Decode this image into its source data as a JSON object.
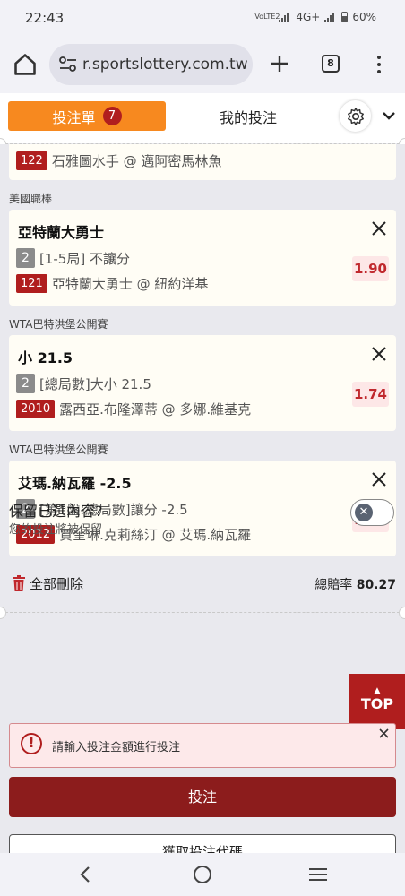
{
  "status_bar": {
    "time": "22:43",
    "network": "VoLTE2",
    "signal_label": "4G+",
    "battery": "60%"
  },
  "browser": {
    "url": "r.sportslottery.com.tw",
    "tab_count": "8"
  },
  "header": {
    "tab_betslip": "投注單",
    "betslip_count": "7",
    "tab_my_bets": "我的投注"
  },
  "partial_card": {
    "game_code": "122",
    "text": "石雅圖水手 @ 邁阿密馬林魚"
  },
  "bets": [
    {
      "league": "美國職棒",
      "title": "亞特蘭大勇士",
      "num": "2",
      "market": "[1-5局] 不讓分",
      "odds": "1.90",
      "game_code": "121",
      "matchup": "亞特蘭大勇士 @ 紐約洋基"
    },
    {
      "league": "WTA巴特洪堡公開賽",
      "title": "小 21.5",
      "num": "2",
      "market": "[總局數]大小 21.5",
      "odds": "1.74",
      "game_code": "2010",
      "matchup": "露西亞.布隆澤蒂 @ 多娜.維基克"
    },
    {
      "league": "WTA巴特洪堡公開賽",
      "title": "艾瑪.納瓦羅 -2.5",
      "num": "2",
      "market": "[第1盤-總局數]讓分 -2.5",
      "odds": "1.90",
      "game_code": "2012",
      "matchup": "賈奎琳.克莉絲汀 @ 艾瑪.納瓦羅"
    }
  ],
  "footer": {
    "delete_all": "全部刪除",
    "total_odds_label": "總賠率",
    "total_odds_value": "80.27",
    "keep_title": "保留已選內容?",
    "keep_subtitle": "您的投注將被保留",
    "top_label": "TOP",
    "warning": "請輸入投注金額進行投注",
    "submit": "投注",
    "secondary": "獲取投注代碼"
  },
  "colors": {
    "accent_orange": "#f7891f",
    "brand_red": "#b01e1e",
    "submit_red": "#8c1c1c",
    "odds_text": "#c0282d"
  }
}
